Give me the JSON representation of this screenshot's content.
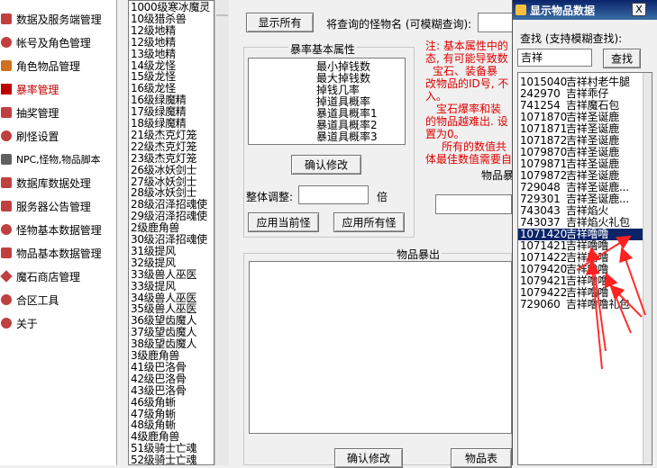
{
  "nav": {
    "items": [
      {
        "label": "数据及服务端管理",
        "color": "#c04040"
      },
      {
        "label": "帐号及角色管理",
        "color": "#c04040"
      },
      {
        "label": "角色物品管理",
        "color": "#c04040"
      },
      {
        "label": "暴率管理",
        "color": "#c04040",
        "active": true
      },
      {
        "label": "抽奖管理",
        "color": "#c04040"
      },
      {
        "label": "刷怪设置",
        "color": "#c04040"
      },
      {
        "label": "NPC,怪物,物品脚本",
        "color": "#404040"
      },
      {
        "label": "数据库数据处理",
        "color": "#c04040"
      },
      {
        "label": "服务器公告管理",
        "color": "#c04040"
      },
      {
        "label": "怪物基本数据管理",
        "color": "#c04040"
      },
      {
        "label": "物品基本数据管理",
        "color": "#c04040"
      },
      {
        "label": "魔石商店管理",
        "color": "#c04040"
      },
      {
        "label": "合区工具",
        "color": "#c04040"
      },
      {
        "label": "关于",
        "color": "#c04040"
      }
    ]
  },
  "monster_list": {
    "items": [
      "1000级寒冰魔灵",
      "10级猎杀兽",
      "12级地精",
      "12级地精",
      "13级地精",
      "14级龙怪",
      "15级龙怪",
      "16级龙怪",
      "16级绿魔精",
      "17级绿魔精",
      "18级绿魔精",
      "21级杰克灯笼",
      "22级杰克灯笼",
      "23级杰克灯笼",
      "26级冰妖剑士",
      "27级冰妖剑士",
      "28级冰妖剑士",
      "28级沼泽招魂使",
      "29级沼泽招魂使",
      "2级鹿角兽",
      "30级沼泽招魂使",
      "31级提风",
      "32级提风",
      "33级兽人巫医",
      "33级提风",
      "34级兽人巫医",
      "35级兽人巫医",
      "36级望齿魔人",
      "37级望齿魔人",
      "38级望齿魔人",
      "3级鹿角兽",
      "41级巴洛骨",
      "42级巴洛骨",
      "43级巴洛骨",
      "46级角蜥",
      "47级角蜥",
      "48级角蜥",
      "4级鹿角兽",
      "51级骑士亡魂",
      "52级骑士亡魂"
    ]
  },
  "toolbar": {
    "show_all": "显示所有",
    "search_label": "将查询的怪物名 (可模糊查询):"
  },
  "drop_props": {
    "title": "暴率基本属性",
    "items": [
      "最小掉钱数",
      "最大掉钱数",
      "掉钱几率",
      "掉道具概率",
      "暴道具概率1",
      "暴道具概率2",
      "暴道具概率3"
    ],
    "confirm": "确认修改",
    "overall_label": "整体调整:",
    "multiplier": "倍",
    "apply_current": "应用当前怪",
    "apply_all": "应用所有怪"
  },
  "notes": {
    "lines": [
      "注: 基本属性中的",
      "态, 有可能导致数",
      "宝石、装备暴",
      "改物品的ID号, 不",
      "入。",
      "宝石爆率和装",
      "的物品越难出. 设",
      "置为0。",
      "所有的数值共",
      "体最佳数值需要自"
    ]
  },
  "item_drop_label": "物品暴",
  "drop_list_title": "物品暴出",
  "bottom": {
    "confirm": "确认修改",
    "item_table": "物品表"
  },
  "dialog": {
    "title": "显示物品数据",
    "close": "X",
    "find_label": "查找 (支持模糊查找):",
    "query": "吉祥",
    "find_btn": "查找",
    "results": [
      {
        "id": "1015040",
        "name": "吉祥村老牛腿"
      },
      {
        "id": "242970",
        "name": "吉祥乖仔"
      },
      {
        "id": "741254",
        "name": "吉祥魔石包"
      },
      {
        "id": "1071870",
        "name": "吉祥圣诞鹿"
      },
      {
        "id": "1071871",
        "name": "吉祥圣诞鹿"
      },
      {
        "id": "1071872",
        "name": "吉祥圣诞鹿"
      },
      {
        "id": "1079870",
        "name": "吉祥圣诞鹿"
      },
      {
        "id": "1079871",
        "name": "吉祥圣诞鹿"
      },
      {
        "id": "1079872",
        "name": "吉祥圣诞鹿"
      },
      {
        "id": "729048",
        "name": "吉祥圣诞鹿..."
      },
      {
        "id": "729301",
        "name": "吉祥圣诞鹿..."
      },
      {
        "id": "743043",
        "name": "吉祥焰火"
      },
      {
        "id": "743037",
        "name": "吉祥焰火礼包"
      },
      {
        "id": "1071420",
        "name": "吉祥噜噜",
        "selected": true
      },
      {
        "id": "1071421",
        "name": "吉祥噜噜"
      },
      {
        "id": "1071422",
        "name": "吉祥噜噜"
      },
      {
        "id": "1079420",
        "name": "吉祥噜噜"
      },
      {
        "id": "1079421",
        "name": "吉祥噜噜"
      },
      {
        "id": "1079422",
        "name": "吉祥噜噜"
      },
      {
        "id": "729060",
        "name": "吉祥噜噜礼包"
      }
    ]
  },
  "colors": {
    "accent_red": "#e00000",
    "title_bar": "#0a246a",
    "selection": "#0a246a"
  }
}
